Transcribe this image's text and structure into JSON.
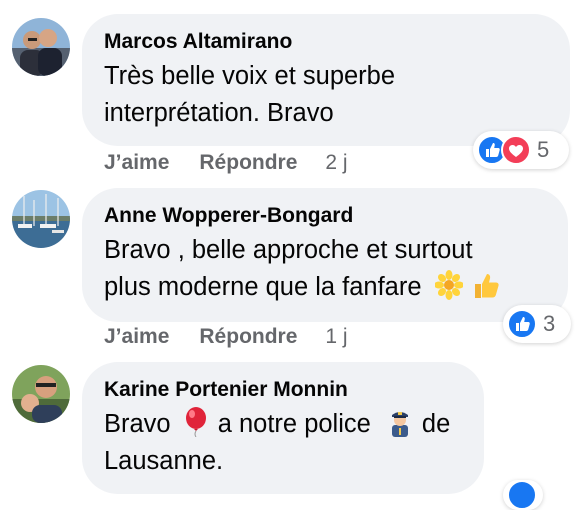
{
  "colors": {
    "bubble": "#f0f2f5",
    "text": "#050505",
    "meta": "#65676b",
    "like_blue": "#1877f2",
    "love_red": "#f33e58"
  },
  "comments": [
    {
      "author": "Marcos Altamirano",
      "text": "Très belle voix et superbe interprétation. Bravo",
      "like_label": "J’aime",
      "reply_label": "Répondre",
      "time": "2 j",
      "reactions": [
        "like-icon",
        "love-icon"
      ],
      "reaction_count": "5"
    },
    {
      "author": "Anne Wopperer-Bongard",
      "text_line1": "Bravo , belle approche et surtout",
      "text_line2": "plus moderne que la fanfare",
      "inline_emojis": [
        "sunflower-emoji",
        "thumbs-up-emoji"
      ],
      "like_label": "J’aime",
      "reply_label": "Répondre",
      "time": "1 j",
      "reactions": [
        "like-icon"
      ],
      "reaction_count": "3"
    },
    {
      "author": "Karine Portenier Monnin",
      "text_part1": "Bravo",
      "text_part2": "a notre police",
      "text_part3": "de",
      "text_line2": "Lausanne.",
      "inline_emojis": [
        "balloon-emoji",
        "police-officer-emoji"
      ]
    }
  ]
}
